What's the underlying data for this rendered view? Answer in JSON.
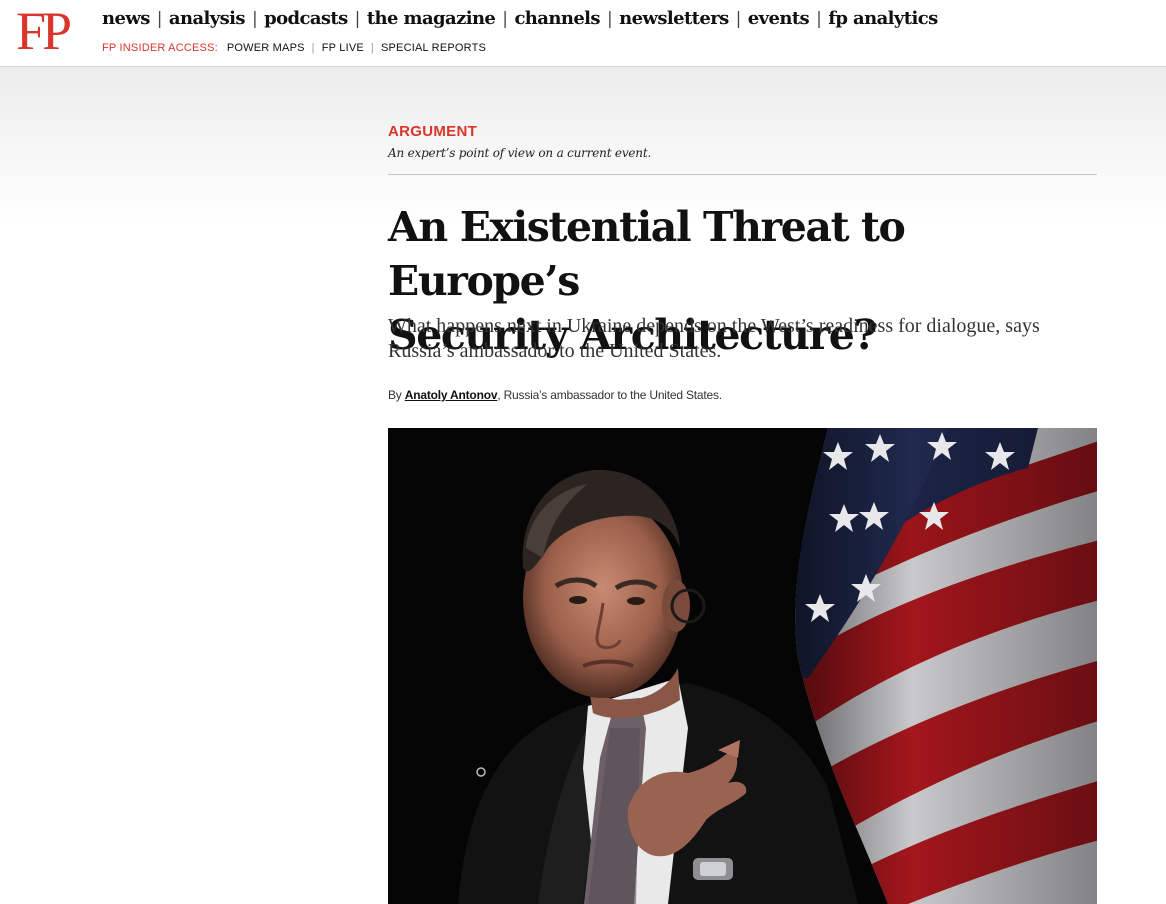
{
  "header": {
    "logo": "FP",
    "nav": [
      {
        "label": "news"
      },
      {
        "label": "analysis"
      },
      {
        "label": "podcasts"
      },
      {
        "label": "the magazine"
      },
      {
        "label": "channels"
      },
      {
        "label": "newsletters"
      },
      {
        "label": "events"
      },
      {
        "label": "fp analytics"
      }
    ],
    "insider_label": "FP INSIDER ACCESS:",
    "secondary": [
      {
        "label": "POWER MAPS"
      },
      {
        "label": "FP LIVE"
      },
      {
        "label": "SPECIAL REPORTS"
      }
    ]
  },
  "article": {
    "kicker": "ARGUMENT",
    "kicker_desc": "An expert’s point of view on a current event.",
    "headline_line1": "An Existential Threat to Europe’s",
    "headline_line2": "Security Architecture?",
    "dek": "What happens next in Ukraine depends on the West’s readiness for dialogue, says Russia’s ambassador to the United States.",
    "byline_prefix": "By ",
    "author": "Anatoly Antonov",
    "author_role": ", Russia’s ambassador to the United States."
  },
  "colors": {
    "brand_red": "#d8362a",
    "text": "#111111"
  }
}
